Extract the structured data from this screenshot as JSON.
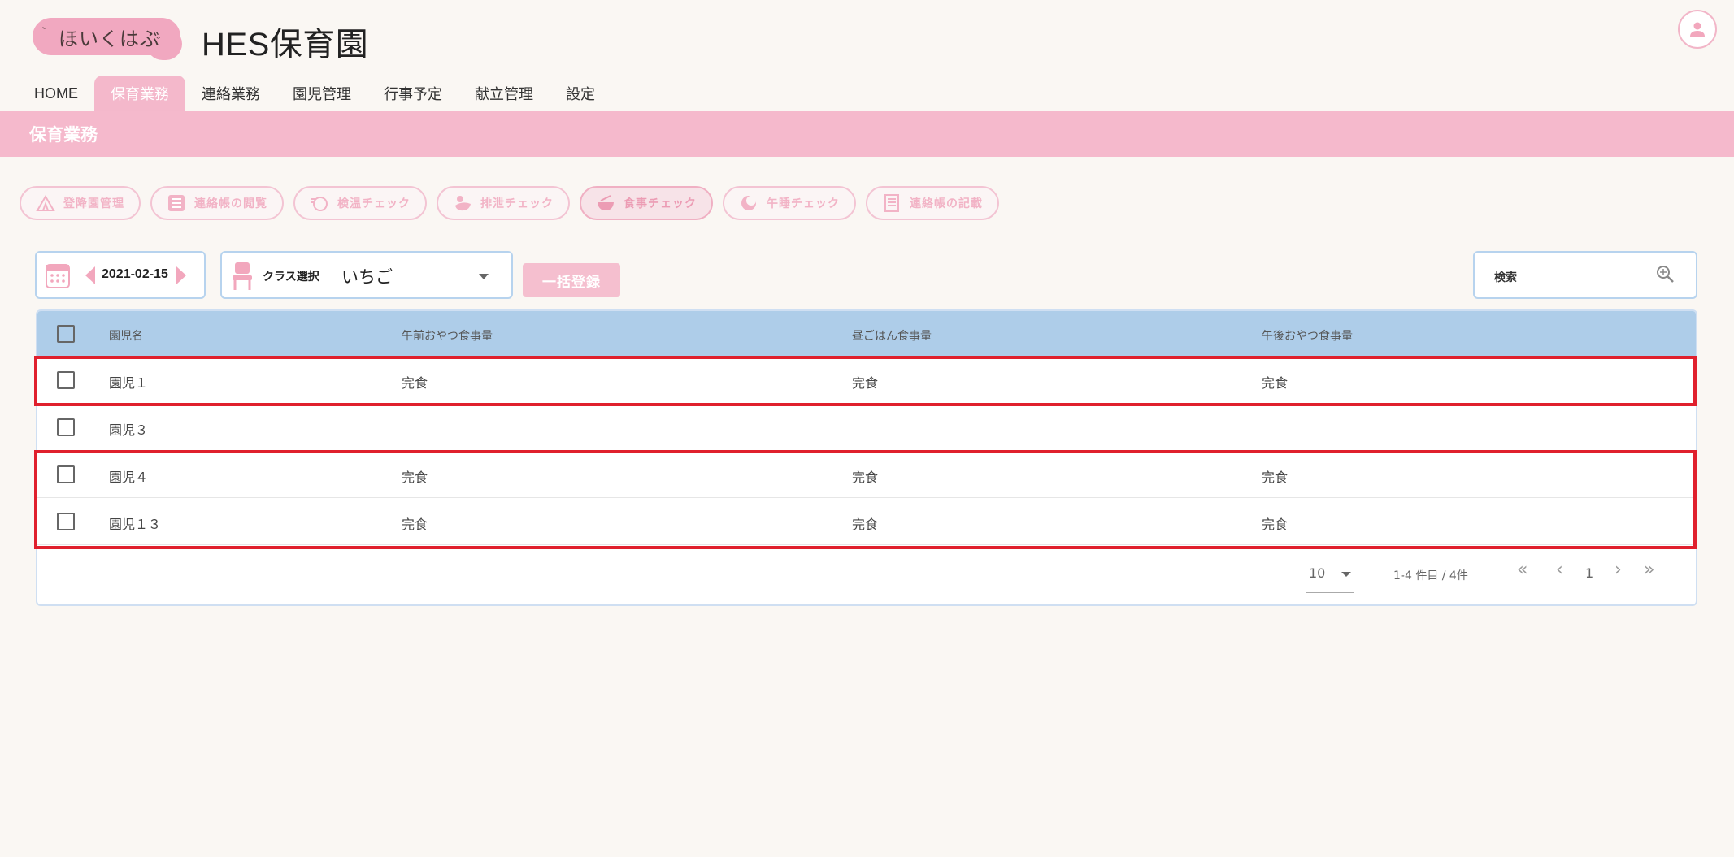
{
  "app": {
    "logo_text": "ほいくはぶ",
    "title": "HES保育園"
  },
  "nav": {
    "tabs": [
      {
        "label": "HOME",
        "active": false
      },
      {
        "label": "保育業務",
        "active": true
      },
      {
        "label": "連絡業務",
        "active": false
      },
      {
        "label": "園児管理",
        "active": false
      },
      {
        "label": "行事予定",
        "active": false
      },
      {
        "label": "献立管理",
        "active": false
      },
      {
        "label": "設定",
        "active": false
      }
    ]
  },
  "section": {
    "title": "保育業務"
  },
  "functions": [
    {
      "label": "登降園管理",
      "icon": "tent-icon",
      "active": false
    },
    {
      "label": "連絡帳の閲覧",
      "icon": "list-icon",
      "active": false
    },
    {
      "label": "検温チェック",
      "icon": "thermometer-icon",
      "active": false
    },
    {
      "label": "排泄チェック",
      "icon": "duck-icon",
      "active": false
    },
    {
      "label": "食事チェック",
      "icon": "bowl-icon",
      "active": true
    },
    {
      "label": "午睡チェック",
      "icon": "moon-icon",
      "active": false
    },
    {
      "label": "連絡帳の記載",
      "icon": "notebook-icon",
      "active": false
    }
  ],
  "toolbar": {
    "date": "2021-02-15",
    "class_label": "クラス選択",
    "class_value": "いちご",
    "bulk_label": "一括登録",
    "search_placeholder": "検索"
  },
  "table": {
    "headers": [
      "園児名",
      "午前おやつ食事量",
      "昼ごはん食事量",
      "午後おやつ食事量"
    ],
    "rows": [
      {
        "name": "園児１",
        "am": "完食",
        "lunch": "完食",
        "pm": "完食"
      },
      {
        "name": "園児３",
        "am": "",
        "lunch": "",
        "pm": ""
      },
      {
        "name": "園児４",
        "am": "完食",
        "lunch": "完食",
        "pm": "完食"
      },
      {
        "name": "園児１３",
        "am": "完食",
        "lunch": "完食",
        "pm": "完食"
      }
    ]
  },
  "pagination": {
    "per_page": "10",
    "range": "1-4 件目 / 4件",
    "page": "1"
  },
  "colors": {
    "accent": "#f4b8cb",
    "header": "#aecde9",
    "highlight": "#e0202d"
  }
}
